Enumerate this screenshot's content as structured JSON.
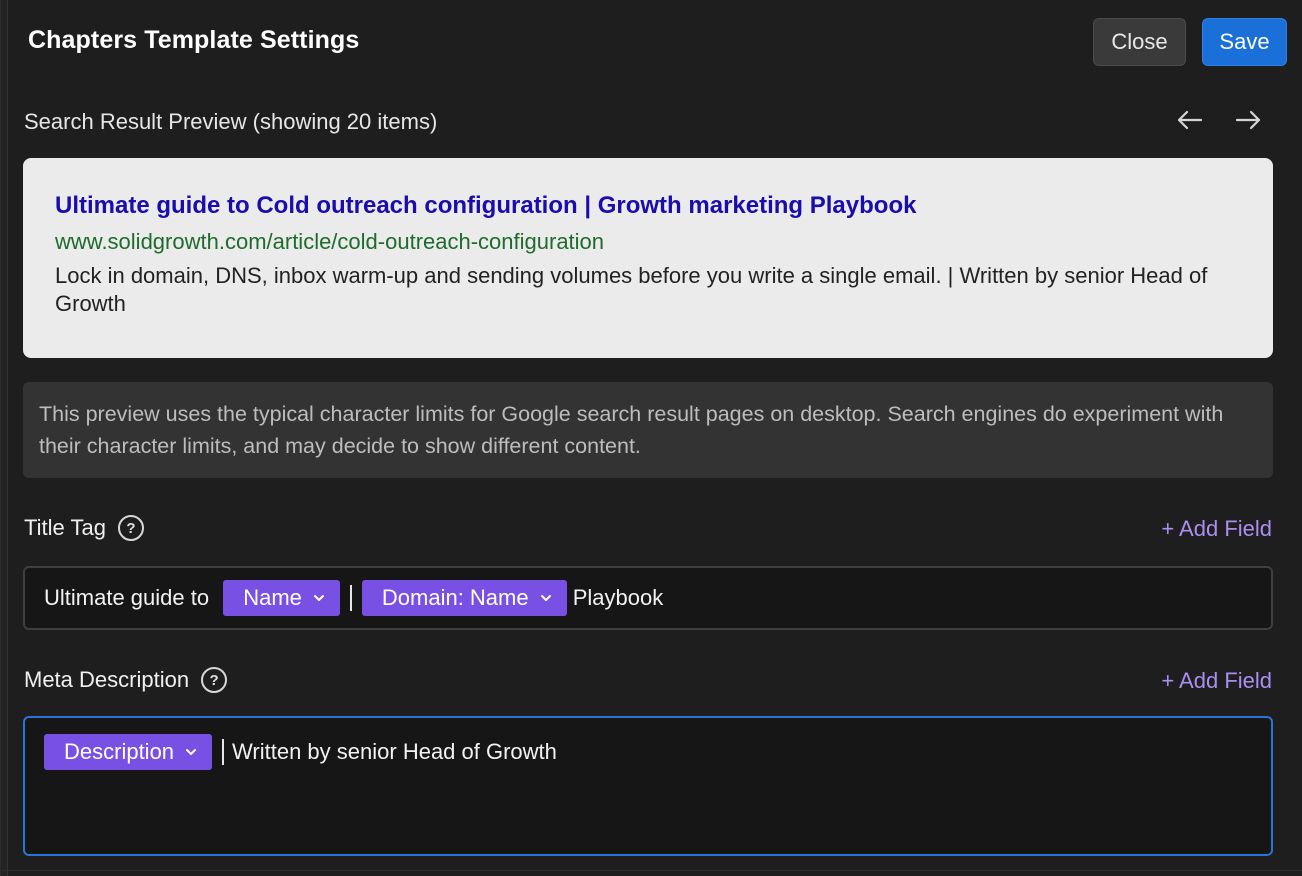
{
  "header": {
    "title": "Chapters Template Settings",
    "close_label": "Close",
    "save_label": "Save"
  },
  "preview": {
    "label": "Search Result Preview (showing 20 items)",
    "prev_icon": "arrow-left-icon",
    "next_icon": "arrow-right-icon",
    "result": {
      "title": "Ultimate guide to Cold outreach configuration | Growth marketing Playbook",
      "url": "www.solidgrowth.com/article/cold-outreach-configuration",
      "description": "Lock in domain, DNS, inbox warm-up and sending volumes before you write a single email. | Written by senior Head of Growth"
    }
  },
  "notice": {
    "text": "This preview uses the typical character limits for Google search result pages on desktop. Search engines do experiment with their character limits, and may decide to show different content."
  },
  "title_tag": {
    "label": "Title Tag",
    "help_icon": "question-circle-icon",
    "add_field_label": "+ Add Field",
    "parts": {
      "prefix": "Ultimate guide to ",
      "chip1": "Name",
      "chip2": "Domain: Name",
      "suffix": " Playbook"
    }
  },
  "meta_description": {
    "label": "Meta Description",
    "help_icon": "question-circle-icon",
    "add_field_label": "+ Add Field",
    "parts": {
      "chip1": "Description",
      "suffix": "Written by senior Head of Growth"
    }
  },
  "colors": {
    "background": "#1e1e1e",
    "accent_blue": "#1a6fd9",
    "chip_purple": "#7950e4",
    "link_purple": "#a98ff0",
    "serp_title": "#1a0dab",
    "serp_url": "#1e6b2c"
  }
}
